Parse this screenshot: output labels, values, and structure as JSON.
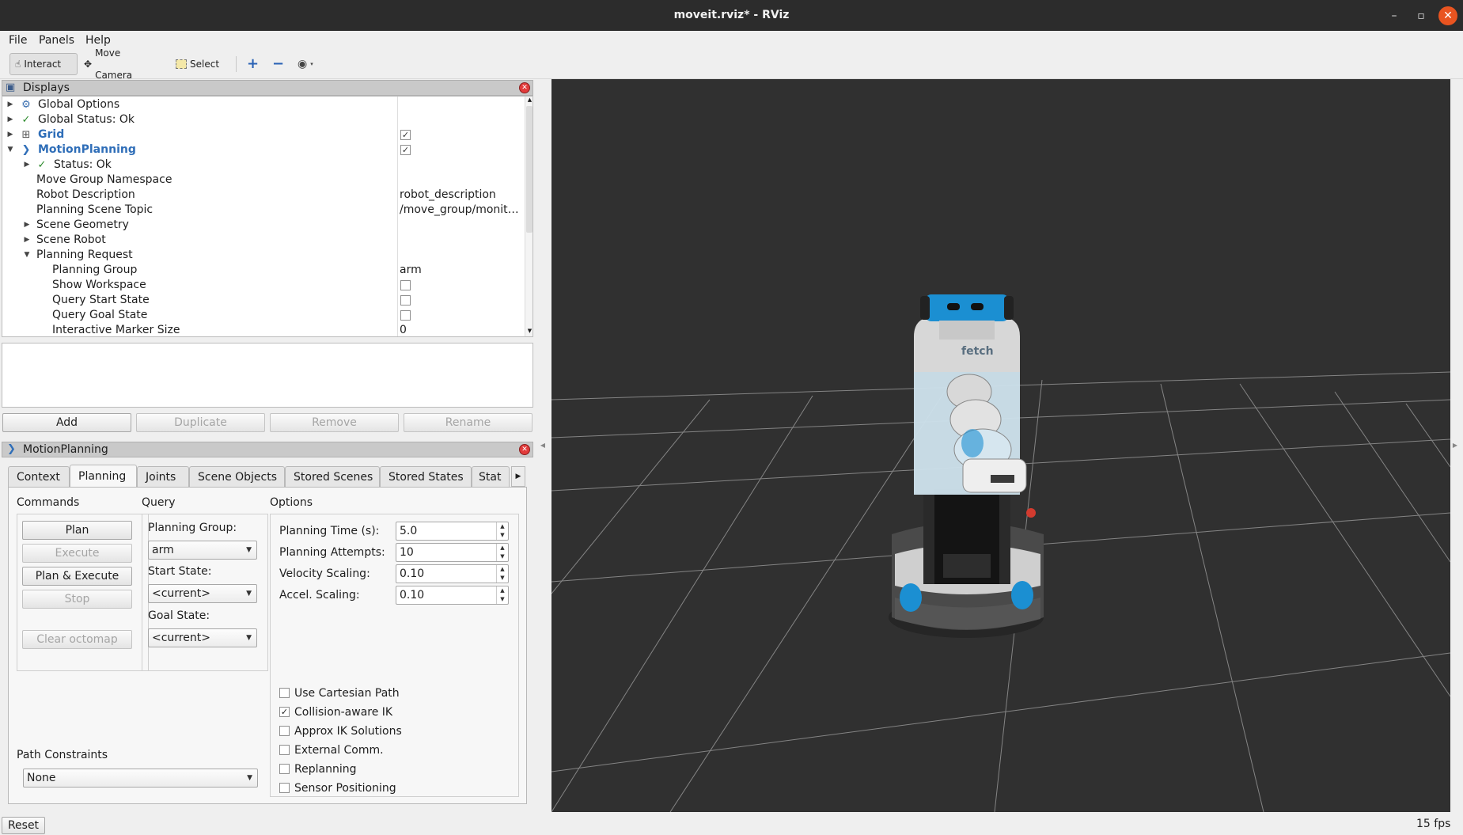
{
  "window": {
    "title": "moveit.rviz* - RViz",
    "minimize": "–",
    "restore": "▫",
    "close": "✕"
  },
  "menu": {
    "file": "File",
    "panels": "Panels",
    "help": "Help"
  },
  "toolbar": {
    "interact": "Interact",
    "move_camera": "Move Camera",
    "select": "Select",
    "icons": {
      "interact": "hand-cursor-icon",
      "move_camera": "camera-move-icon",
      "select": "select-rect-icon",
      "add": "plus-icon",
      "remove": "minus-icon",
      "view": "eye-icon"
    }
  },
  "displays": {
    "title": "Displays",
    "rows": [
      {
        "label": "Global Options"
      },
      {
        "label": "Global Status: Ok",
        "status_mark": "✓"
      },
      {
        "label": "Grid",
        "checked": true
      },
      {
        "label": "MotionPlanning",
        "checked": true
      },
      {
        "label": "Status: Ok",
        "status_mark": "✓"
      },
      {
        "label": "Move Group Namespace",
        "value": ""
      },
      {
        "label": "Robot Description",
        "value": "robot_description"
      },
      {
        "label": "Planning Scene Topic",
        "value": "/move_group/monit…"
      },
      {
        "label": "Scene Geometry"
      },
      {
        "label": "Scene Robot"
      },
      {
        "label": "Planning Request"
      },
      {
        "label": "Planning Group",
        "value": "arm"
      },
      {
        "label": "Show Workspace",
        "checked": false
      },
      {
        "label": "Query Start State",
        "checked": false
      },
      {
        "label": "Query Goal State",
        "checked": false
      },
      {
        "label": "Interactive Marker Size",
        "value": "0"
      }
    ],
    "buttons": {
      "add": "Add",
      "duplicate": "Duplicate",
      "remove": "Remove",
      "rename": "Rename"
    }
  },
  "motion_planning": {
    "title": "MotionPlanning",
    "tabs": [
      "Context",
      "Planning",
      "Joints",
      "Scene Objects",
      "Stored Scenes",
      "Stored States",
      "Stat"
    ],
    "selected_tab": "Planning",
    "commands": {
      "title": "Commands",
      "plan": "Plan",
      "execute": "Execute",
      "plan_execute": "Plan & Execute",
      "stop": "Stop",
      "clear_octomap": "Clear octomap"
    },
    "query": {
      "title": "Query",
      "planning_group_label": "Planning Group:",
      "planning_group": "arm",
      "start_state_label": "Start State:",
      "start_state": "<current>",
      "goal_state_label": "Goal State:",
      "goal_state": "<current>"
    },
    "options": {
      "title": "Options",
      "planning_time_label": "Planning Time (s):",
      "planning_time": "5.0",
      "planning_attempts_label": "Planning Attempts:",
      "planning_attempts": "10",
      "velocity_scaling_label": "Velocity Scaling:",
      "velocity_scaling": "0.10",
      "accel_scaling_label": "Accel. Scaling:",
      "accel_scaling": "0.10",
      "checkboxes": [
        {
          "label": "Use Cartesian Path",
          "checked": false
        },
        {
          "label": "Collision-aware IK",
          "checked": true
        },
        {
          "label": "Approx IK Solutions",
          "checked": false
        },
        {
          "label": "External Comm.",
          "checked": false
        },
        {
          "label": "Replanning",
          "checked": false
        },
        {
          "label": "Sensor Positioning",
          "checked": false
        }
      ]
    },
    "path_constraints": {
      "label": "Path Constraints",
      "value": "None"
    }
  },
  "viewport": {
    "robot_logo": "fetch",
    "colors": {
      "background": "#303030",
      "robot_accent": "#1b8fd2"
    }
  },
  "statusbar": {
    "reset": "Reset",
    "fps": "15 fps"
  }
}
